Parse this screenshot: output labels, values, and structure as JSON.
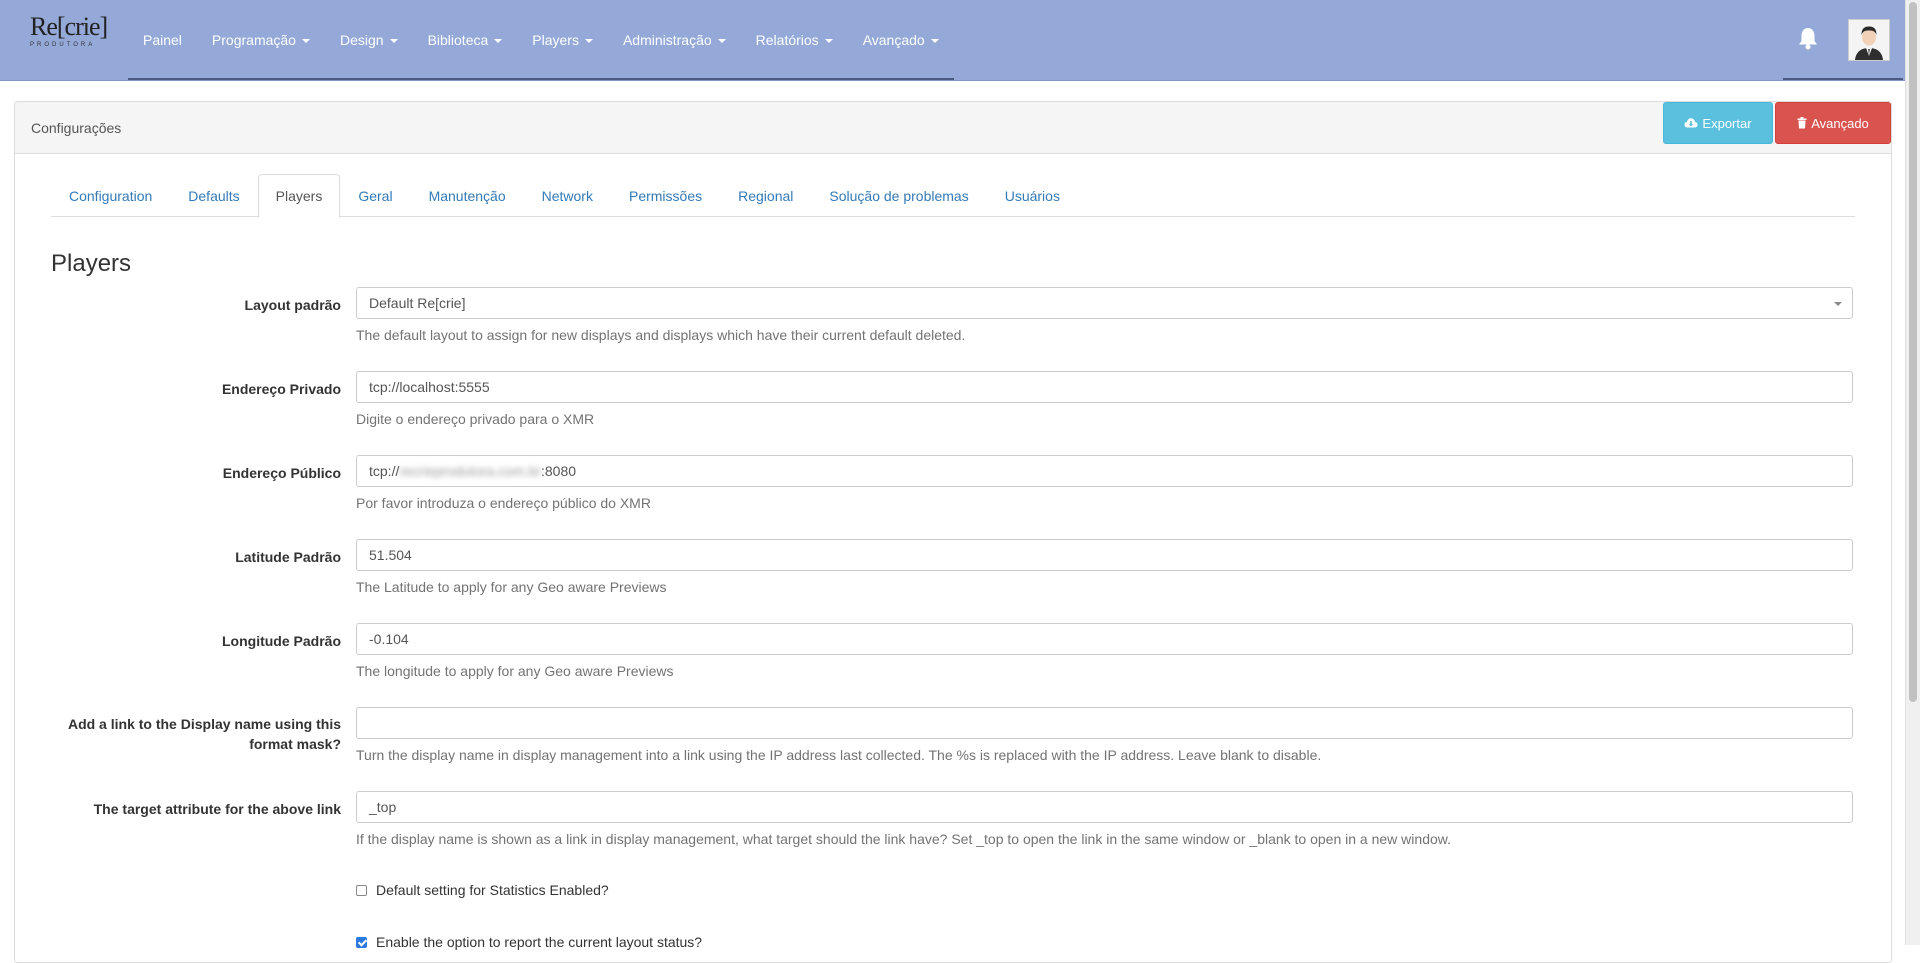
{
  "navbar": {
    "logo_main": "Re[crie]",
    "logo_sub": "PRODUTORA",
    "items": [
      {
        "label": "Painel",
        "dropdown": false
      },
      {
        "label": "Programação",
        "dropdown": true
      },
      {
        "label": "Design",
        "dropdown": true
      },
      {
        "label": "Biblioteca",
        "dropdown": true
      },
      {
        "label": "Players",
        "dropdown": true
      },
      {
        "label": "Administração",
        "dropdown": true
      },
      {
        "label": "Relatórios",
        "dropdown": true
      },
      {
        "label": "Avançado",
        "dropdown": true
      }
    ],
    "color": "#94a9d7"
  },
  "page": {
    "title": "Configurações",
    "export_label": "Exportar",
    "advanced_label": "Avançado"
  },
  "tabs": [
    {
      "label": "Configuration",
      "active": false
    },
    {
      "label": "Defaults",
      "active": false
    },
    {
      "label": "Players",
      "active": true
    },
    {
      "label": "Geral",
      "active": false
    },
    {
      "label": "Manutenção",
      "active": false
    },
    {
      "label": "Network",
      "active": false
    },
    {
      "label": "Permissões",
      "active": false
    },
    {
      "label": "Regional",
      "active": false
    },
    {
      "label": "Solução de problemas",
      "active": false
    },
    {
      "label": "Usuários",
      "active": false
    }
  ],
  "section": {
    "title": "Players"
  },
  "fields": {
    "layout": {
      "label": "Layout padrão",
      "value": "Default Re[crie]",
      "help": "The default layout to assign for new displays and displays which have their current default deleted."
    },
    "private_address": {
      "label": "Endereço Privado",
      "value": "tcp://localhost:5555",
      "help": "Digite o endereço privado para o XMR"
    },
    "public_address": {
      "label": "Endereço Público",
      "value_prefix": "tcp://",
      "value_blurred": "recrieprodutora.com.br",
      "value_suffix": ":8080",
      "help": "Por favor introduza o endereço público do XMR"
    },
    "latitude": {
      "label": "Latitude Padrão",
      "value": "51.504",
      "help": "The Latitude to apply for any Geo aware Previews"
    },
    "longitude": {
      "label": "Longitude Padrão",
      "value": "-0.104",
      "help": "The longitude to apply for any Geo aware Previews"
    },
    "link_mask": {
      "label_line1": "Add a link to the Display name using this",
      "label_line2": "format mask?",
      "value": "",
      "help": "Turn the display name in display management into a link using the IP address last collected. The %s is replaced with the IP address. Leave blank to disable."
    },
    "link_target": {
      "label": "The target attribute for the above link",
      "value": "_top",
      "help": "If the display name is shown as a link in display management, what target should the link have? Set _top to open the link in the same window or _blank to open in a new window."
    },
    "stats_enabled": {
      "label": "Default setting for Statistics Enabled?",
      "checked": false
    },
    "layout_status": {
      "label": "Enable the option to report the current layout status?",
      "checked": true
    }
  }
}
